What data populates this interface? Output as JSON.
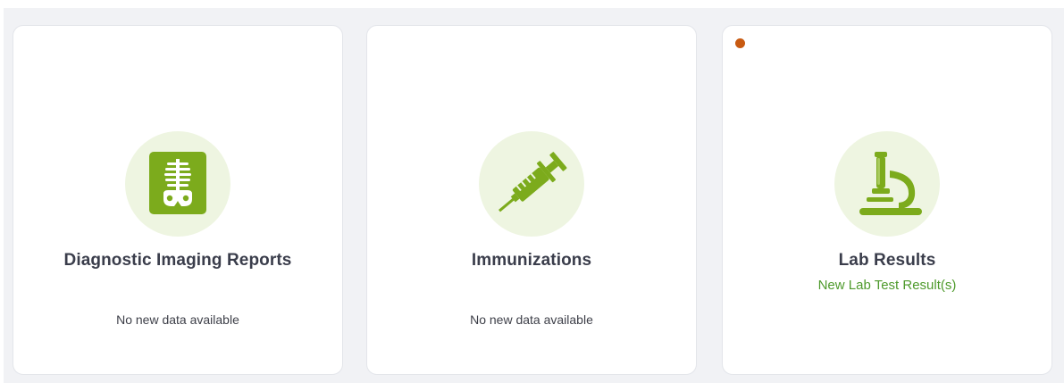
{
  "colors": {
    "accent_green": "#7cab1c",
    "icon_bg": "#eef5e1",
    "subtitle_green": "#4e9a2c",
    "notification_dot": "#c85a11",
    "panel_bg": "#f1f2f5"
  },
  "cards": [
    {
      "title": "Diagnostic Imaging Reports",
      "subtitle": "",
      "status": "No new data available",
      "icon": "xray-icon",
      "has_notification": false
    },
    {
      "title": "Immunizations",
      "subtitle": "",
      "status": "No new data available",
      "icon": "syringe-icon",
      "has_notification": false
    },
    {
      "title": "Lab Results",
      "subtitle": "New Lab Test Result(s)",
      "status": "",
      "icon": "microscope-icon",
      "has_notification": true
    }
  ]
}
